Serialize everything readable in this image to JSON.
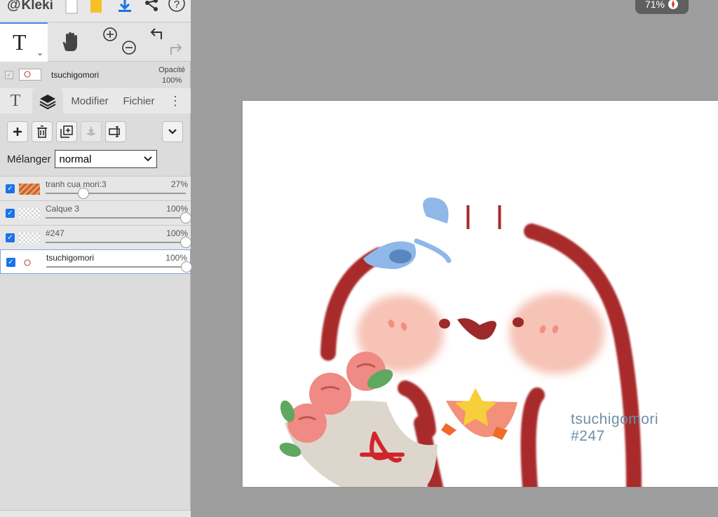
{
  "app": {
    "name": "Kleki"
  },
  "zoom": {
    "level": "71%"
  },
  "current_layer": {
    "name": "tsuchigomori",
    "opacity_label": "Opacité",
    "opacity_value": "100%"
  },
  "tabs": [
    {
      "icon": "text-tool-icon"
    },
    {
      "icon": "layers-icon",
      "active": true
    },
    {
      "label": "Modifier"
    },
    {
      "label": "Fichier"
    }
  ],
  "blend": {
    "label": "Mélanger",
    "value": "normal"
  },
  "layers": [
    {
      "name": "tranh cua mori:3",
      "opacity": "27%",
      "opacity_fraction": 0.27,
      "checked": true
    },
    {
      "name": "Calque 3",
      "opacity": "100%",
      "opacity_fraction": 1.0,
      "checked": true
    },
    {
      "name": "#247",
      "opacity": "100%",
      "opacity_fraction": 1.0,
      "checked": true
    },
    {
      "name": "tsuchigomori",
      "opacity": "100%",
      "opacity_fraction": 1.0,
      "checked": true,
      "active": true
    }
  ],
  "canvas_text": {
    "line1": "tsuchigomori",
    "line2": "#247"
  },
  "colors": {
    "accent": "#1a73e8",
    "stroke": "#a52a2a",
    "signature": "#6e8fa6"
  }
}
